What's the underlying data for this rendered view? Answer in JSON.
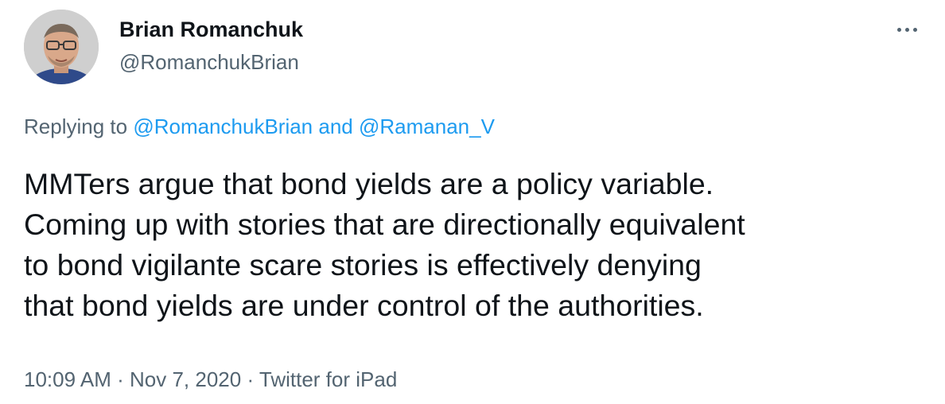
{
  "author": {
    "name": "Brian Romanchuk",
    "handle": "@RomanchukBrian",
    "avatar_icon": "profile-photo"
  },
  "reply": {
    "prefix": "Replying to",
    "mention1": "@RomanchukBrian",
    "conjunction": "and",
    "mention2": "@Ramanan_V"
  },
  "tweet": {
    "lines": [
      "MMTers argue that bond yields are a policy variable.",
      "Coming up with stories that are directionally equivalent",
      "to bond vigilante scare stories is effectively denying",
      "that bond yields are under control of the authorities."
    ]
  },
  "meta": {
    "time": "10:09 AM",
    "separator": "·",
    "date": "Nov 7, 2020",
    "source": "Twitter for iPad"
  },
  "more_icon": "more-dots-icon",
  "colors": {
    "text": "#0f1419",
    "secondary": "#536471",
    "link": "#1d9bf0",
    "background": "#ffffff"
  }
}
